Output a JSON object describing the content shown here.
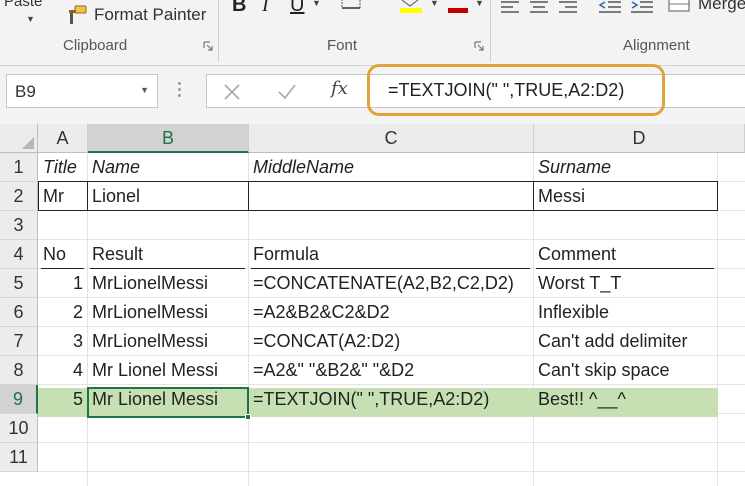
{
  "ribbon": {
    "paste_label": "Paste",
    "format_painter_label": "Format Painter",
    "merge_label": "Merge",
    "groups": {
      "clipboard": "Clipboard",
      "font": "Font",
      "alignment": "Alignment"
    },
    "font_color_accent": "#c00000",
    "fill_color_accent": "#ffff00"
  },
  "formula_bar": {
    "name_box": "B9",
    "formula": "=TEXTJOIN(\" \",TRUE,A2:D2)",
    "highlight_color": "#e0a23a"
  },
  "grid": {
    "columns": [
      "A",
      "B",
      "C",
      "D"
    ],
    "rows": [
      "1",
      "2",
      "3",
      "4",
      "5",
      "6",
      "7",
      "8",
      "9",
      "10",
      "11"
    ],
    "selected_column": "B",
    "selected_row": "9",
    "header_row": {
      "a": "Title",
      "b": "Name",
      "c": "MiddleName",
      "d": "Surname"
    },
    "data_row": {
      "a": "Mr",
      "b": "Lionel",
      "c": "",
      "d": "Messi"
    },
    "table_header": {
      "a": "No",
      "b": "Result",
      "c": "Formula",
      "d": "Comment"
    },
    "table_rows": [
      {
        "no": "1",
        "result": "MrLionelMessi",
        "formula": "=CONCATENATE(A2,B2,C2,D2)",
        "comment": "Worst T_T"
      },
      {
        "no": "2",
        "result": "MrLionelMessi",
        "formula": "=A2&B2&C2&D2",
        "comment": "Inflexible"
      },
      {
        "no": "3",
        "result": "MrLionelMessi",
        "formula": "=CONCAT(A2:D2)",
        "comment": "Can't add delimiter"
      },
      {
        "no": "4",
        "result": "Mr Lionel Messi",
        "formula": "=A2&\" \"&B2&\" \"&D2",
        "comment": "Can't skip space"
      },
      {
        "no": "5",
        "result": "Mr Lionel Messi",
        "formula": "=TEXTJOIN(\" \",TRUE,A2:D2)",
        "comment": "Best!! ^__^"
      }
    ],
    "highlight_fill": "#c6e0b4",
    "selection_color": "#217346"
  }
}
